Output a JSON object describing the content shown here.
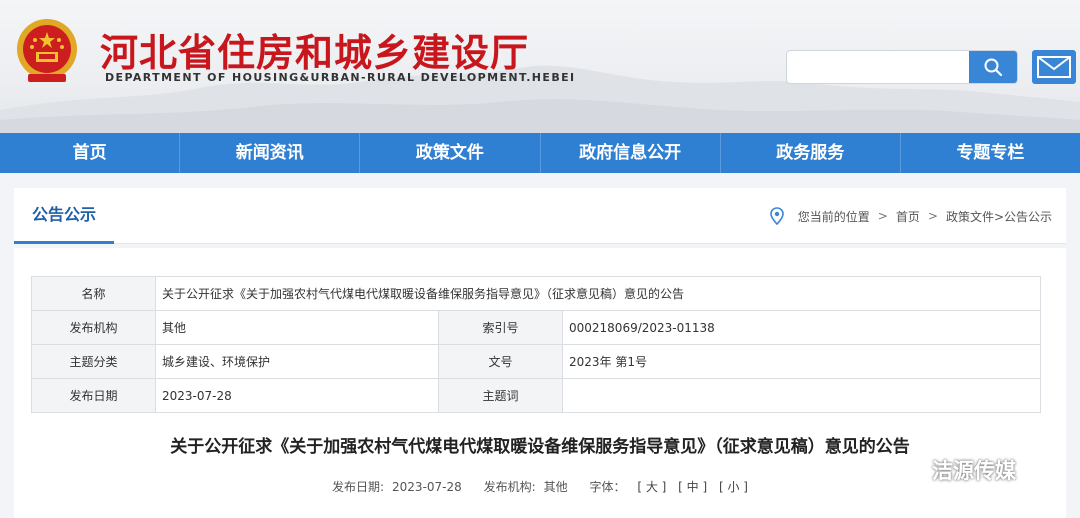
{
  "header": {
    "title": "河北省住房和城乡建设厅",
    "subtitle": "DEPARTMENT OF HOUSING&URBAN-RURAL DEVELOPMENT.HEBEI",
    "emblem_icon": "national-emblem-icon",
    "search": {
      "placeholder": "",
      "value": "",
      "icon": "search-icon"
    },
    "mail_icon": "mail-icon",
    "accent_color": "#c8161d"
  },
  "nav": {
    "items": [
      {
        "label": "首页"
      },
      {
        "label": "新闻资讯"
      },
      {
        "label": "政策文件"
      },
      {
        "label": "政府信息公开"
      },
      {
        "label": "政务服务"
      },
      {
        "label": "专题专栏"
      }
    ],
    "color": "#2f7fd2"
  },
  "section": {
    "title": "公告公示",
    "breadcrumb": {
      "prefix": "您当前的位置",
      "items": [
        "首页",
        "政策文件>公告公示"
      ],
      "separator": ">"
    }
  },
  "meta": {
    "name_label": "名称",
    "name_value": "关于公开征求《关于加强农村气代煤电代煤取暖设备维保服务指导意见》（征求意见稿）意见的公告",
    "publisher_label": "发布机构",
    "publisher_value": "其他",
    "index_label": "索引号",
    "index_value": "000218069/2023-01138",
    "category_label": "主题分类",
    "category_value": "城乡建设、环境保护",
    "docno_label": "文号",
    "docno_value": "2023年 第1号",
    "date_label": "发布日期",
    "date_value": "2023-07-28",
    "keywords_label": "主题词",
    "keywords_value": ""
  },
  "document": {
    "title": "关于公开征求《关于加强农村气代煤电代煤取暖设备维保服务指导意见》（征求意见稿）意见的公告",
    "date_label": "发布日期:",
    "date_value": "2023-07-28",
    "publisher_label": "发布机构:",
    "publisher_value": "其他",
    "fontsize_label": "字体：",
    "fontsize_large": "[ 大 ]",
    "fontsize_medium": "[ 中 ]",
    "fontsize_small": "[ 小 ]"
  },
  "watermark": {
    "text": "洁源传媒",
    "icon": "wechat-icon"
  }
}
